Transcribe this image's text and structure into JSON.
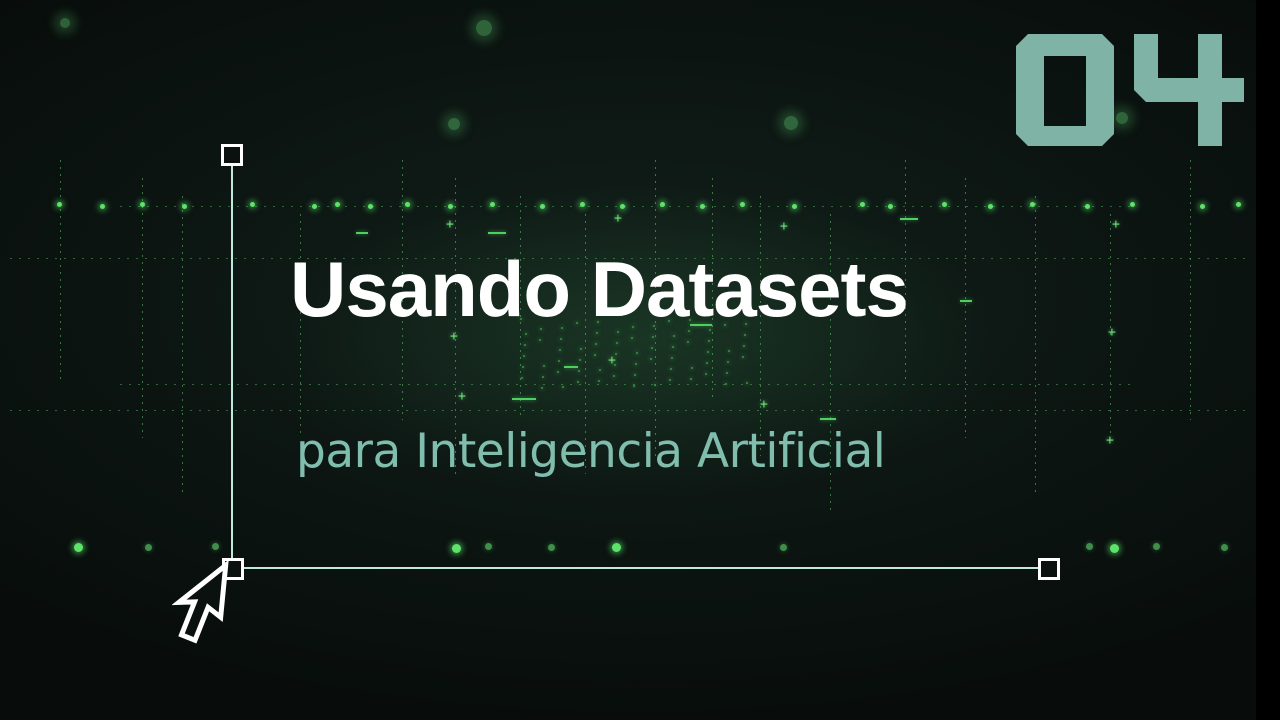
{
  "video": {
    "title": "Usando Datasets",
    "subtitle": "para Inteligencia Artificial",
    "episode_number": "04"
  },
  "colors": {
    "background": "#0b110f",
    "accent_green": "#5ee36a",
    "subtitle_teal": "#86c6b6",
    "episode_number": "#7fb3a6",
    "frame_line": "#bfe9dc",
    "title_text": "#ffffff"
  },
  "icons": {
    "cursor": "mouse-pointer-arrow-icon"
  }
}
